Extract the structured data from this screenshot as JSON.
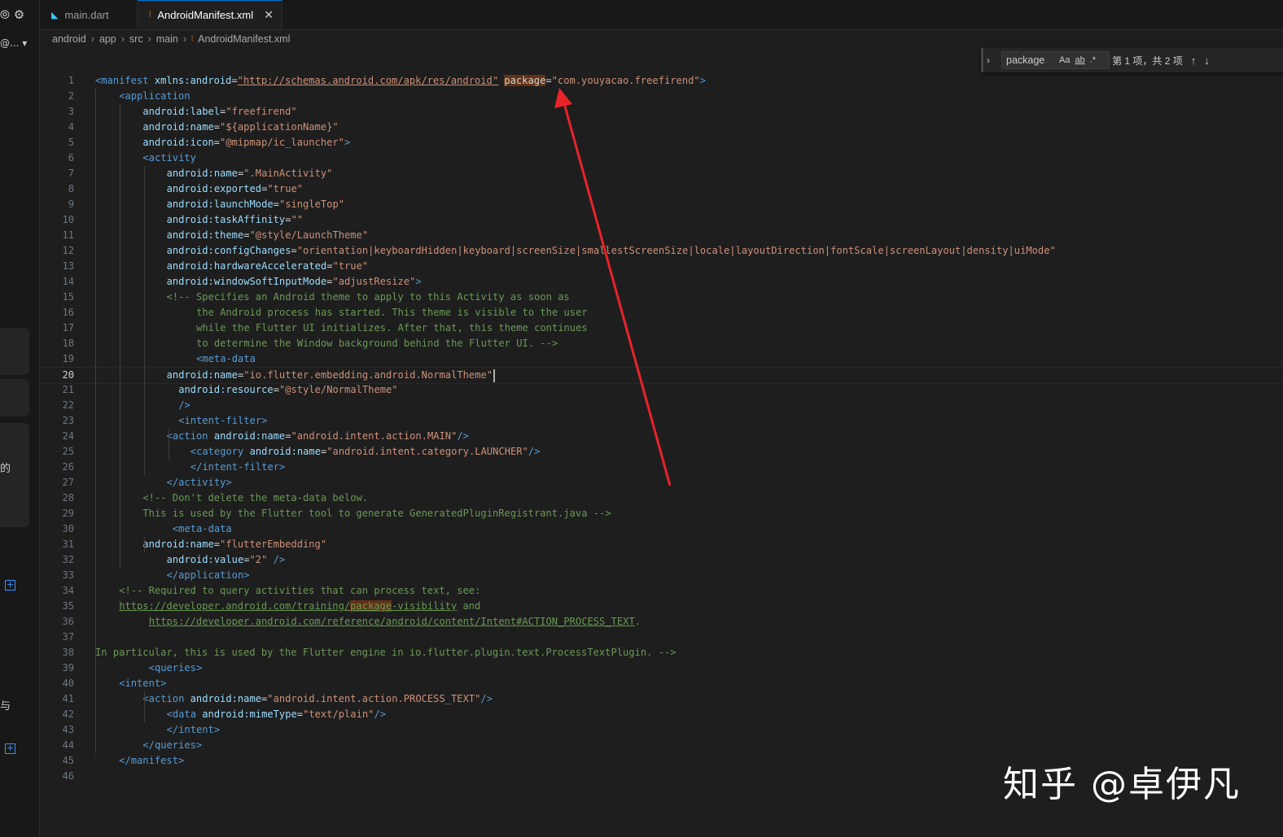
{
  "left_strip": {
    "icons": "⦾ ⚙",
    "at_label": "@... ▾",
    "cjk_1": "的",
    "cjk_2": "与"
  },
  "tabs": [
    {
      "label": "main.dart",
      "active": false,
      "icon": "dart-icon"
    },
    {
      "label": "AndroidManifest.xml",
      "active": true,
      "icon": "xml-rss-icon"
    }
  ],
  "breadcrumbs": [
    "android",
    "app",
    "src",
    "main",
    "AndroidManifest.xml"
  ],
  "find_widget": {
    "query": "package",
    "match_case": "Aa",
    "whole_word": "ab",
    "regex": ".*",
    "result": "第 1 项，共 2 项",
    "prev": "↑",
    "next": "↓"
  },
  "current_line": 20,
  "code_lines": [
    [
      [
        "t",
        "<"
      ],
      [
        "t",
        "manifest"
      ],
      [
        "p",
        " "
      ],
      [
        "a",
        "xmlns:android"
      ],
      [
        "p",
        "="
      ],
      [
        "vl",
        "\"http://schemas.android.com/apk/res/android\""
      ],
      [
        "p",
        " "
      ],
      [
        "ah",
        "package"
      ],
      [
        "p",
        "="
      ],
      [
        "v",
        "\"com.youyacao.freefirend\""
      ],
      [
        "t",
        ">"
      ]
    ],
    [
      [
        "t",
        "<"
      ],
      [
        "t",
        "application"
      ]
    ],
    [
      [
        "a",
        "android:label"
      ],
      [
        "p",
        "="
      ],
      [
        "v",
        "\"freefirend\""
      ]
    ],
    [
      [
        "a",
        "android:name"
      ],
      [
        "p",
        "="
      ],
      [
        "v",
        "\"${applicationName}\""
      ]
    ],
    [
      [
        "a",
        "android:icon"
      ],
      [
        "p",
        "="
      ],
      [
        "v",
        "\"@mipmap/ic_launcher\""
      ],
      [
        "t",
        ">"
      ]
    ],
    [
      [
        "t",
        "<"
      ],
      [
        "t",
        "activity"
      ]
    ],
    [
      [
        "a",
        "android:name"
      ],
      [
        "p",
        "="
      ],
      [
        "v",
        "\".MainActivity\""
      ]
    ],
    [
      [
        "a",
        "android:exported"
      ],
      [
        "p",
        "="
      ],
      [
        "v",
        "\"true\""
      ]
    ],
    [
      [
        "a",
        "android:launchMode"
      ],
      [
        "p",
        "="
      ],
      [
        "v",
        "\"singleTop\""
      ]
    ],
    [
      [
        "a",
        "android:taskAffinity"
      ],
      [
        "p",
        "="
      ],
      [
        "v",
        "\"\""
      ]
    ],
    [
      [
        "a",
        "android:theme"
      ],
      [
        "p",
        "="
      ],
      [
        "v",
        "\"@style/LaunchTheme\""
      ]
    ],
    [
      [
        "a",
        "android:configChanges"
      ],
      [
        "p",
        "="
      ],
      [
        "v",
        "\"orientation|keyboardHidden|keyboard|screenSize|smallestScreenSize|locale|layoutDirection|fontScale|screenLayout|density|uiMode\""
      ]
    ],
    [
      [
        "a",
        "android:hardwareAccelerated"
      ],
      [
        "p",
        "="
      ],
      [
        "v",
        "\"true\""
      ]
    ],
    [
      [
        "a",
        "android:windowSoftInputMode"
      ],
      [
        "p",
        "="
      ],
      [
        "v",
        "\"adjustResize\""
      ],
      [
        "t",
        ">"
      ]
    ],
    [
      [
        "c",
        "<!-- Specifies an Android theme to apply to this Activity as soon as"
      ]
    ],
    [
      [
        "c",
        "the Android process has started. This theme is visible to the user"
      ]
    ],
    [
      [
        "c",
        "while the Flutter UI initializes. After that, this theme continues"
      ]
    ],
    [
      [
        "c",
        "to determine the Window background behind the Flutter UI. -->"
      ]
    ],
    [
      [
        "t",
        "<"
      ],
      [
        "t",
        "meta-data"
      ]
    ],
    [
      [
        "a",
        "android:name"
      ],
      [
        "p",
        "="
      ],
      [
        "v",
        "\"io.flutter.embedding.android.NormalTheme\""
      ],
      [
        "caret",
        ""
      ]
    ],
    [
      [
        "a",
        "android:resource"
      ],
      [
        "p",
        "="
      ],
      [
        "v",
        "\"@style/NormalTheme\""
      ]
    ],
    [
      [
        "t",
        "/>"
      ]
    ],
    [
      [
        "t",
        "<"
      ],
      [
        "t",
        "intent-filter"
      ],
      [
        "t",
        ">"
      ]
    ],
    [
      [
        "t",
        "<"
      ],
      [
        "t",
        "action"
      ],
      [
        "p",
        " "
      ],
      [
        "a",
        "android:name"
      ],
      [
        "p",
        "="
      ],
      [
        "v",
        "\"android.intent.action.MAIN\""
      ],
      [
        "t",
        "/>"
      ]
    ],
    [
      [
        "t",
        "<"
      ],
      [
        "t",
        "category"
      ],
      [
        "p",
        " "
      ],
      [
        "a",
        "android:name"
      ],
      [
        "p",
        "="
      ],
      [
        "v",
        "\"android.intent.category.LAUNCHER\""
      ],
      [
        "t",
        "/>"
      ]
    ],
    [
      [
        "t",
        "</"
      ],
      [
        "t",
        "intent-filter"
      ],
      [
        "t",
        ">"
      ]
    ],
    [
      [
        "t",
        "</"
      ],
      [
        "t",
        "activity"
      ],
      [
        "t",
        ">"
      ]
    ],
    [
      [
        "c",
        "<!-- Don't delete the meta-data below."
      ]
    ],
    [
      [
        "c",
        "This is used by the Flutter tool to generate GeneratedPluginRegistrant.java -->"
      ]
    ],
    [
      [
        "t",
        "<"
      ],
      [
        "t",
        "meta-data"
      ]
    ],
    [
      [
        "a",
        "android:name"
      ],
      [
        "p",
        "="
      ],
      [
        "v",
        "\"flutterEmbedding\""
      ]
    ],
    [
      [
        "a",
        "android:value"
      ],
      [
        "p",
        "="
      ],
      [
        "v",
        "\"2\""
      ],
      [
        "p",
        " "
      ],
      [
        "t",
        "/>"
      ]
    ],
    [
      [
        "t",
        "</"
      ],
      [
        "t",
        "application"
      ],
      [
        "t",
        ">"
      ]
    ],
    [
      [
        "c",
        "<!-- Required to query activities that can process text, see:"
      ]
    ],
    [
      [
        "cl",
        "https://developer.android.com/training/"
      ],
      [
        "clh",
        "package"
      ],
      [
        "cl",
        "-visibility"
      ],
      [
        "c",
        " and"
      ]
    ],
    [
      [
        "cl",
        "https://developer.android.com/reference/android/content/Intent#ACTION_PROCESS_TEXT"
      ],
      [
        "c",
        "."
      ]
    ],
    [],
    [
      [
        "c",
        "In particular, this is used by the Flutter engine in io.flutter.plugin.text.ProcessTextPlugin. -->"
      ]
    ],
    [
      [
        "t",
        "<"
      ],
      [
        "t",
        "queries"
      ],
      [
        "t",
        ">"
      ]
    ],
    [
      [
        "t",
        "<"
      ],
      [
        "t",
        "intent"
      ],
      [
        "t",
        ">"
      ]
    ],
    [
      [
        "t",
        "<"
      ],
      [
        "t",
        "action"
      ],
      [
        "p",
        " "
      ],
      [
        "a",
        "android:name"
      ],
      [
        "p",
        "="
      ],
      [
        "v",
        "\"android.intent.action.PROCESS_TEXT\""
      ],
      [
        "t",
        "/>"
      ]
    ],
    [
      [
        "t",
        "<"
      ],
      [
        "t",
        "data"
      ],
      [
        "p",
        " "
      ],
      [
        "a",
        "android:mimeType"
      ],
      [
        "p",
        "="
      ],
      [
        "v",
        "\"text/plain\""
      ],
      [
        "t",
        "/>"
      ]
    ],
    [
      [
        "t",
        "</"
      ],
      [
        "t",
        "intent"
      ],
      [
        "t",
        ">"
      ]
    ],
    [
      [
        "t",
        "</"
      ],
      [
        "t",
        "queries"
      ],
      [
        "t",
        ">"
      ]
    ],
    [
      [
        "t",
        "</"
      ],
      [
        "t",
        "manifest"
      ],
      [
        "t",
        ">"
      ]
    ],
    []
  ],
  "watermark": "知乎 @卓伊凡",
  "colors": {
    "arrow": "#e8232a",
    "tag": "#569cd6",
    "attr": "#9cdcfe",
    "value": "#ce9178",
    "comment": "#6a9955",
    "find_highlight": "#613214"
  }
}
